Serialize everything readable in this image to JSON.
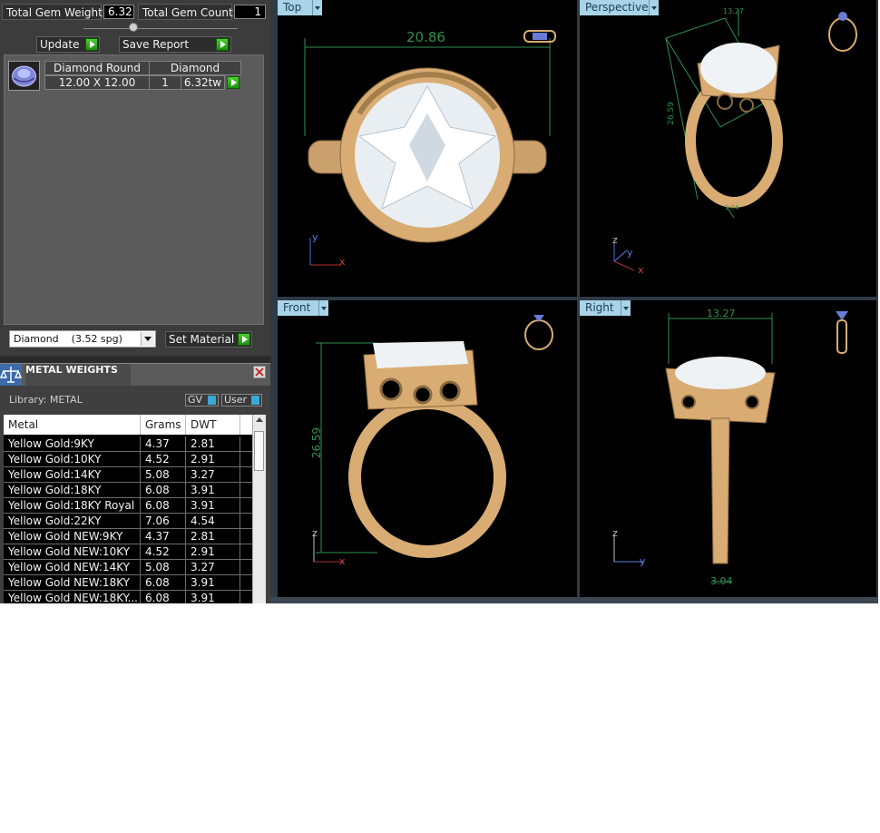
{
  "gem_summary": {
    "total_weight_label": "Total Gem Weight",
    "total_weight_value": "6.32",
    "total_count_label": "Total Gem Count",
    "total_count_value": "1",
    "update_label": "Update",
    "save_report_label": "Save Report"
  },
  "gem_table": {
    "headers": [
      "Diamond Round",
      "Diamond"
    ],
    "rows": [
      {
        "size": "12.00 X 12.00",
        "qty": "1",
        "weight": "6.32tw"
      }
    ]
  },
  "material": {
    "selected": "Diamond    (3.52 spg)",
    "set_label": "Set Material"
  },
  "metal_weights": {
    "title": "METAL WEIGHTS",
    "library_label": "Library: METAL",
    "toggles": [
      "GV",
      "User"
    ],
    "columns": [
      "Metal",
      "Grams",
      "DWT"
    ],
    "rows": [
      {
        "metal": "Yellow Gold:9KY",
        "grams": "4.37",
        "dwt": "2.81"
      },
      {
        "metal": "Yellow Gold:10KY",
        "grams": "4.52",
        "dwt": "2.91"
      },
      {
        "metal": "Yellow Gold:14KY",
        "grams": "5.08",
        "dwt": "3.27"
      },
      {
        "metal": "Yellow Gold:18KY",
        "grams": "6.08",
        "dwt": "3.91"
      },
      {
        "metal": "Yellow Gold:18KY Royal",
        "grams": "6.08",
        "dwt": "3.91"
      },
      {
        "metal": "Yellow Gold:22KY",
        "grams": "7.06",
        "dwt": "4.54"
      },
      {
        "metal": "Yellow Gold NEW:9KY",
        "grams": "4.37",
        "dwt": "2.81"
      },
      {
        "metal": "Yellow Gold NEW:10KY",
        "grams": "4.52",
        "dwt": "2.91"
      },
      {
        "metal": "Yellow Gold NEW:14KY",
        "grams": "5.08",
        "dwt": "3.27"
      },
      {
        "metal": "Yellow Gold NEW:18KY",
        "grams": "6.08",
        "dwt": "3.91"
      },
      {
        "metal": "Yellow Gold NEW:18KY...",
        "grams": "6.08",
        "dwt": "3.91"
      }
    ]
  },
  "viewports": {
    "top": {
      "label": "Top",
      "dimension": "20.86",
      "axes": [
        "y",
        "x"
      ]
    },
    "perspective": {
      "label": "Perspective",
      "dimensions": [
        "13.27",
        "26.59",
        "3.04"
      ],
      "axes": [
        "z",
        "y",
        "x"
      ]
    },
    "front": {
      "label": "Front",
      "dimension": "26.59",
      "axes": [
        "z",
        "x"
      ]
    },
    "right": {
      "label": "Right",
      "dimensions": [
        "13.27",
        "3.04"
      ],
      "axes": [
        "z",
        "y"
      ]
    }
  },
  "colors": {
    "gold": "#d8ac72",
    "tab": "#a9d3e7",
    "dimension_green": "#2f8f4f",
    "go_green": "#33b41f"
  }
}
